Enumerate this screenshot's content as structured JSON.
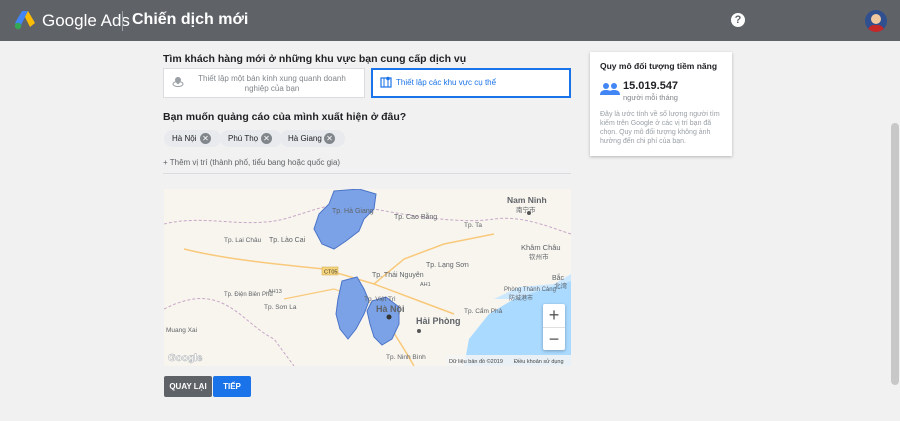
{
  "header": {
    "brand": "Google Ads",
    "campaign_title": "Chiến dịch mới",
    "help_icon": "?",
    "colors": {
      "bar": "#5f6368",
      "accent": "#1a73e8"
    }
  },
  "targeting": {
    "question": "Tìm khách hàng mới ở những khu vực bạn cung cấp dịch vụ",
    "option_radius": "Thiết lập một bán kính xung quanh doanh nghiệp của bạn",
    "option_areas": "Thiết lập các khu vực cụ thể",
    "selected": "option_areas"
  },
  "locations": {
    "question": "Bạn muốn quảng cáo của mình xuất hiện ở đâu?",
    "chips": [
      {
        "label": "Hà Nội"
      },
      {
        "label": "Phú Thọ"
      },
      {
        "label": "Hà Giang"
      }
    ],
    "add_location": "+ Thêm vị trí (thành phố, tiểu bang hoặc quốc gia)"
  },
  "map": {
    "labels": {
      "nanning": "Nam Ninh",
      "nanning_cn": "南宁市",
      "ha_giang": "Tp. Hà Giang",
      "cao_bang": "Tp. Cao Bằng",
      "tp_lai_chau": "Tp. Lai Châu",
      "lao_cai": "Tp. Lào Cai",
      "lang_son": "Tp. Lạng Sơn",
      "tp_ta": "Tp. Ta",
      "thai_nguyen": "Tp. Thái Nguyên",
      "viet_tri": "Tp. Việt Trì",
      "son_la": "Tp. Sơn La",
      "ha_noi": "Hà Nội",
      "hai_phong": "Hải Phòng",
      "cam_pha": "Tp. Cẩm Phả",
      "ninh_binh": "Tp. Ninh Bình",
      "khamchau": "Khâm Châu",
      "khamchau_cn": "钦州市",
      "bac": "Bắc",
      "bac_cn": "北湾",
      "phong_thanh": "Phòng Thành Cảng",
      "phong_thanh_cn": "防城港市",
      "muang_xai": "Muang Xai",
      "dien_bien": "Tp. Điện Biên Phủ",
      "road_ct05": "CT05",
      "road_ah13": "AH13",
      "road_ah1": "AH1",
      "google": "Google",
      "attribution": "Dữ liệu bản đồ ©2019",
      "terms": "Điều khoản sử dụng"
    },
    "zoom_in": "+",
    "zoom_out": "−"
  },
  "buttons": {
    "back": "QUAY LẠI",
    "next": "TIẾP"
  },
  "audience": {
    "title": "Quy mô đối tượng tiềm năng",
    "count": "15.019.547",
    "per_month": "người mỗi tháng",
    "note": "Đây là ước tính về số lượng người tìm kiếm trên Google ở các vị trí bạn đã chọn. Quy mô đối tượng không ảnh hưởng đến chi phí của bạn."
  }
}
